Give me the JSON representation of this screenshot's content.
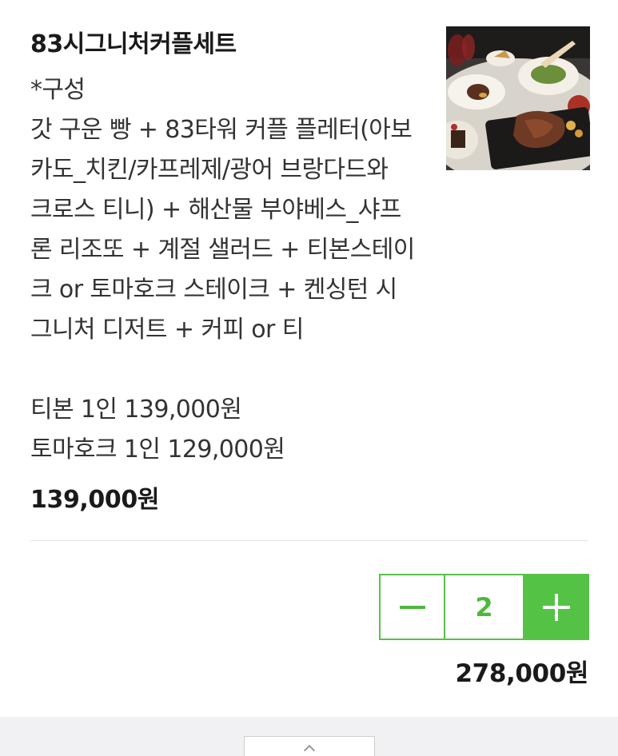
{
  "product": {
    "title": "83시그니처커플세트",
    "description_lines": [
      "*구성",
      "갓 구운 빵 + 83타워 커플 플레터(아보",
      "카도_치킨/카프레제/광어 브랑다드와",
      "크로스 티니) + 해산물 부야베스_샤프",
      "론 리조또 + 계절 샐러드 + 티본스테이",
      "크 or 토마호크 스테이크 + 켄싱턴 시",
      "그니처 디저트 + 커피 or 티",
      "",
      "티본 1인 139,000원",
      "토마호크 1인 129,000원"
    ],
    "price": "139,000원",
    "image_icon": "steak-dinner-photo"
  },
  "quantity": {
    "value": "2",
    "minus_icon": "minus-icon",
    "plus_icon": "plus-icon"
  },
  "total": "278,000원",
  "colors": {
    "accent_green": "#54c245",
    "stepper_border": "#5bbf4a",
    "footer_band": "#f1f1f3"
  }
}
